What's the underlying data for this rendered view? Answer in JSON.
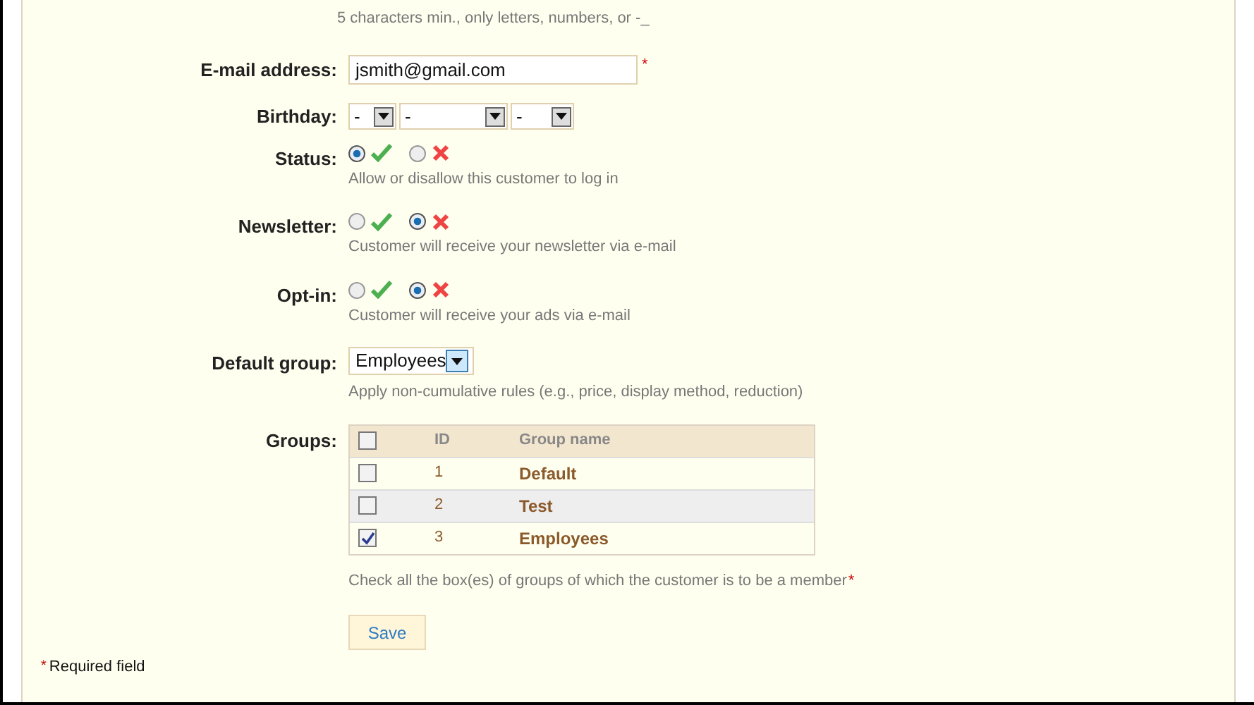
{
  "top_hint": "5 characters min., only letters, numbers, or -_",
  "email": {
    "label": "E-mail address:",
    "value": "jsmith@gmail.com",
    "required_mark": "*"
  },
  "birthday": {
    "label": "Birthday:",
    "selects": [
      {
        "value": "-"
      },
      {
        "value": "-"
      },
      {
        "value": "-"
      }
    ]
  },
  "toggles": [
    {
      "label": "Status:",
      "yes_selected": true,
      "hint": "Allow or disallow this customer to log in"
    },
    {
      "label": "Newsletter:",
      "yes_selected": false,
      "hint": "Customer will receive your newsletter via e-mail"
    },
    {
      "label": "Opt-in:",
      "yes_selected": false,
      "hint": "Customer will receive your ads via e-mail"
    }
  ],
  "default_group": {
    "label": "Default group:",
    "value": "Employees",
    "hint": "Apply non-cumulative rules (e.g., price, display method, reduction)"
  },
  "groups": {
    "label": "Groups:",
    "header_checked": false,
    "columns": [
      "ID",
      "Group name"
    ],
    "rows": [
      {
        "id": "1",
        "name": "Default",
        "checked": false
      },
      {
        "id": "2",
        "name": "Test",
        "checked": false
      },
      {
        "id": "3",
        "name": "Employees",
        "checked": true
      }
    ],
    "hint": "Check all the box(es) of groups of which the customer is to be a member",
    "required_mark": "*"
  },
  "save_button": "Save",
  "footer": {
    "required_mark": "*",
    "text": "Required field"
  }
}
